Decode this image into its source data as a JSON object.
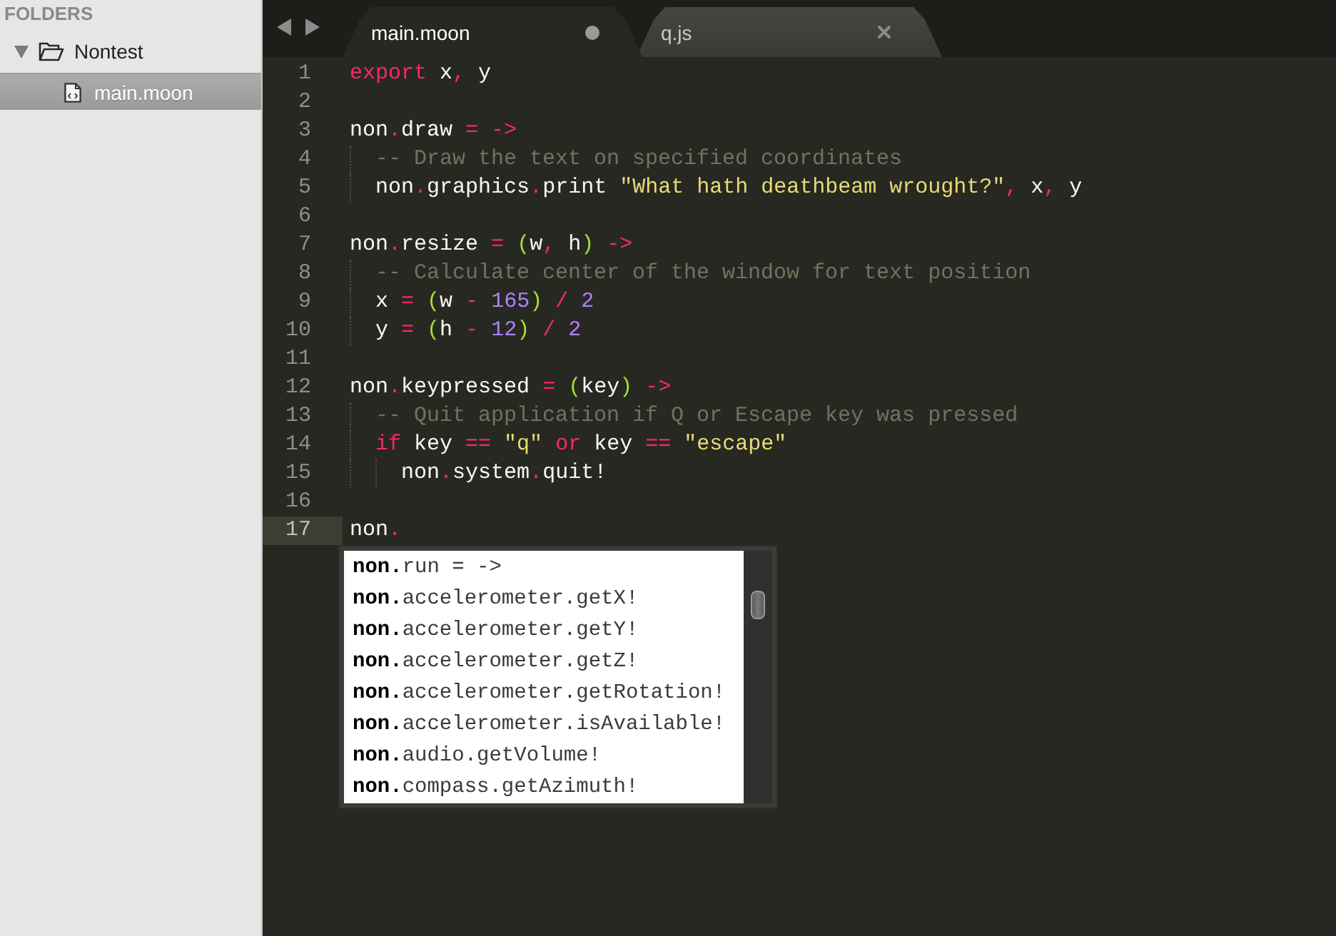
{
  "sidebar": {
    "title": "FOLDERS",
    "tree": [
      {
        "kind": "folder",
        "label": "Nontest",
        "expanded": true,
        "selected": false,
        "children": [
          {
            "kind": "file",
            "label": "main.moon",
            "selected": true
          }
        ]
      }
    ]
  },
  "tab_bar": {
    "tabs": [
      {
        "label": "main.moon",
        "selected": true,
        "modified": true
      },
      {
        "label": "q.js",
        "selected": false,
        "modified": false
      }
    ]
  },
  "editor": {
    "lines": [
      {
        "number": "1",
        "current": false,
        "tokens": [
          {
            "text": "export",
            "kind": "keyword"
          },
          {
            "text": " x",
            "kind": "plain"
          },
          {
            "text": ",",
            "kind": "keyword"
          },
          {
            "text": " y",
            "kind": "plain"
          }
        ]
      },
      {
        "number": "2",
        "current": false
      },
      {
        "number": "3",
        "current": false,
        "tokens": [
          {
            "text": "non",
            "kind": "plain"
          },
          {
            "text": ".",
            "kind": "keyword"
          },
          {
            "text": "draw ",
            "kind": "plain"
          },
          {
            "text": "= ->",
            "kind": "keyword"
          }
        ],
        "children": [
          {
            "number": "4",
            "current": false,
            "tokens": [
              {
                "text": "-- Draw the text on specified coordinates",
                "kind": "comment"
              }
            ]
          },
          {
            "number": "5",
            "current": false,
            "tokens": [
              {
                "text": "non",
                "kind": "plain"
              },
              {
                "text": ".",
                "kind": "keyword"
              },
              {
                "text": "graphics",
                "kind": "plain"
              },
              {
                "text": ".",
                "kind": "keyword"
              },
              {
                "text": "print ",
                "kind": "plain"
              },
              {
                "text": "\"What hath deathbeam wrought?\"",
                "kind": "string"
              },
              {
                "text": ",",
                "kind": "keyword"
              },
              {
                "text": " x",
                "kind": "plain"
              },
              {
                "text": ",",
                "kind": "keyword"
              },
              {
                "text": " y",
                "kind": "plain"
              }
            ]
          }
        ]
      },
      {
        "number": "6",
        "current": false
      },
      {
        "number": "7",
        "current": false,
        "tokens": [
          {
            "text": "non",
            "kind": "plain"
          },
          {
            "text": ".",
            "kind": "keyword"
          },
          {
            "text": "resize ",
            "kind": "plain"
          },
          {
            "text": "=",
            "kind": "keyword"
          },
          {
            "text": " (",
            "kind": "paren"
          },
          {
            "text": "w",
            "kind": "plain"
          },
          {
            "text": ",",
            "kind": "keyword"
          },
          {
            "text": " h",
            "kind": "plain"
          },
          {
            "text": ")",
            "kind": "paren"
          },
          {
            "text": " ->",
            "kind": "keyword"
          }
        ],
        "children": [
          {
            "number": "8",
            "current": false,
            "tokens": [
              {
                "text": "-- Calculate center of the window for text position",
                "kind": "comment"
              }
            ]
          },
          {
            "number": "9",
            "current": false,
            "tokens": [
              {
                "text": "x ",
                "kind": "plain"
              },
              {
                "text": "=",
                "kind": "keyword"
              },
              {
                "text": " (",
                "kind": "paren"
              },
              {
                "text": "w ",
                "kind": "plain"
              },
              {
                "text": "-",
                "kind": "keyword"
              },
              {
                "text": " 165",
                "kind": "number"
              },
              {
                "text": ")",
                "kind": "paren"
              },
              {
                "text": " /",
                "kind": "keyword"
              },
              {
                "text": " 2",
                "kind": "number"
              }
            ]
          },
          {
            "number": "10",
            "current": false,
            "tokens": [
              {
                "text": "y ",
                "kind": "plain"
              },
              {
                "text": "=",
                "kind": "keyword"
              },
              {
                "text": " (",
                "kind": "paren"
              },
              {
                "text": "h ",
                "kind": "plain"
              },
              {
                "text": "-",
                "kind": "keyword"
              },
              {
                "text": " 12",
                "kind": "number"
              },
              {
                "text": ")",
                "kind": "paren"
              },
              {
                "text": " /",
                "kind": "keyword"
              },
              {
                "text": " 2",
                "kind": "number"
              }
            ]
          }
        ]
      },
      {
        "number": "11",
        "current": false
      },
      {
        "number": "12",
        "current": false,
        "tokens": [
          {
            "text": "non",
            "kind": "plain"
          },
          {
            "text": ".",
            "kind": "keyword"
          },
          {
            "text": "keypressed ",
            "kind": "plain"
          },
          {
            "text": "=",
            "kind": "keyword"
          },
          {
            "text": " (",
            "kind": "paren"
          },
          {
            "text": "key",
            "kind": "plain"
          },
          {
            "text": ")",
            "kind": "paren"
          },
          {
            "text": " ->",
            "kind": "keyword"
          }
        ],
        "children": [
          {
            "number": "13",
            "current": false,
            "tokens": [
              {
                "text": "-- Quit application if Q or Escape key was pressed",
                "kind": "comment"
              }
            ]
          },
          {
            "number": "14",
            "current": false,
            "tokens": [
              {
                "text": "if",
                "kind": "keyword"
              },
              {
                "text": " key ",
                "kind": "plain"
              },
              {
                "text": "==",
                "kind": "keyword"
              },
              {
                "text": " \"q\"",
                "kind": "string"
              },
              {
                "text": " or",
                "kind": "keyword"
              },
              {
                "text": " key ",
                "kind": "plain"
              },
              {
                "text": "==",
                "kind": "keyword"
              },
              {
                "text": " \"escape\"",
                "kind": "string"
              }
            ],
            "children": [
              {
                "number": "15",
                "current": false,
                "tokens": [
                  {
                    "text": "non",
                    "kind": "plain"
                  },
                  {
                    "text": ".",
                    "kind": "keyword"
                  },
                  {
                    "text": "system",
                    "kind": "plain"
                  },
                  {
                    "text": ".",
                    "kind": "keyword"
                  },
                  {
                    "text": "quit!",
                    "kind": "plain"
                  }
                ]
              }
            ]
          }
        ]
      },
      {
        "number": "16",
        "current": false
      },
      {
        "number": "17",
        "current": true,
        "tokens": [
          {
            "text": "non",
            "kind": "plain"
          },
          {
            "text": ".",
            "kind": "keyword"
          }
        ]
      }
    ]
  },
  "autocomplete": {
    "items": [
      "**non.**run = ->",
      "**non.**accelerometer.getX!",
      "**non.**accelerometer.getY!",
      "**non.**accelerometer.getZ!",
      "**non.**accelerometer.getRotation!",
      "**non.**accelerometer.isAvailable!",
      "**non.**audio.getVolume!",
      "**non.**compass.getAzimuth!"
    ]
  }
}
